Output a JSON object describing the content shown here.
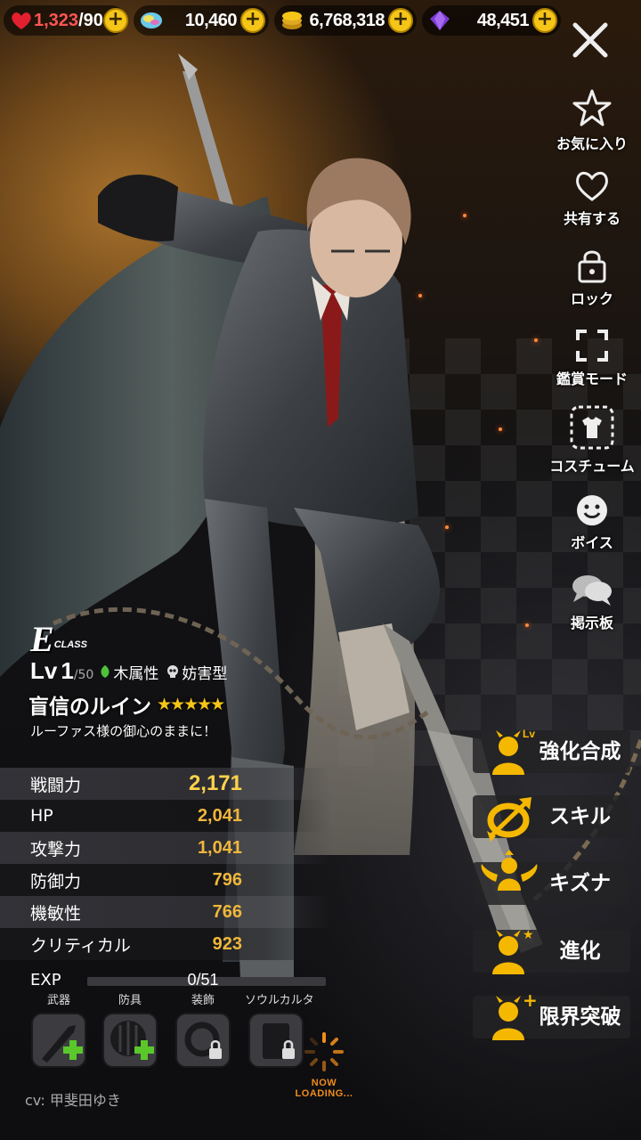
{
  "resources": [
    {
      "icon": "heart-icon",
      "value": "1,323",
      "max": "/90"
    },
    {
      "icon": "rainbow-crystal-icon",
      "value": "10,460"
    },
    {
      "icon": "gold-coin-icon",
      "value": "6,768,318"
    },
    {
      "icon": "purple-gem-icon",
      "value": "48,451"
    }
  ],
  "plus_symbol": "+",
  "side_menu": [
    {
      "icon": "star-icon",
      "label": "お気に入り"
    },
    {
      "icon": "heart-outline-icon",
      "label": "共有する"
    },
    {
      "icon": "lock-icon",
      "label": "ロック"
    },
    {
      "icon": "fullscreen-icon",
      "label": "鑑賞モード"
    },
    {
      "icon": "costume-icon",
      "label": "コスチューム"
    },
    {
      "icon": "smile-icon",
      "label": "ボイス"
    },
    {
      "icon": "chat-bubble-icon",
      "label": "掲示板"
    }
  ],
  "character": {
    "class_letter": "E",
    "class_label": "CLASS",
    "level_prefix": "Lv",
    "level": "1",
    "level_max": "/50",
    "element": "木属性",
    "type": "妨害型",
    "name": "盲信のルイン",
    "stars": "★★★★★",
    "quote": "ルーファス様の御心のままに！"
  },
  "stats": [
    {
      "label": "戦闘力",
      "value": "2,171"
    },
    {
      "label": "HP",
      "value": "2,041"
    },
    {
      "label": "攻撃力",
      "value": "1,041"
    },
    {
      "label": "防御力",
      "value": "796"
    },
    {
      "label": "機敏性",
      "value": "766"
    },
    {
      "label": "クリティカル",
      "value": "923"
    }
  ],
  "exp": {
    "label": "EXP",
    "value": "0/51",
    "progress": 0
  },
  "equipment": [
    {
      "label": "武器",
      "icon": "weapon-knife-icon"
    },
    {
      "label": "防具",
      "icon": "armor-shield-icon"
    },
    {
      "label": "装飾",
      "icon": "accessory-ring-icon"
    },
    {
      "label": "ソウルカルタ",
      "icon": "soul-card-icon"
    }
  ],
  "cv": "cv: 甲斐田ゆき",
  "loading_text": "NOW LOADING...",
  "actions": [
    {
      "label": "強化合成",
      "badge": "Lv"
    },
    {
      "label": "スキル",
      "badge": ""
    },
    {
      "label": "キズナ",
      "badge": ""
    },
    {
      "label": "進化",
      "badge": "★"
    },
    {
      "label": "限界突破",
      "badge": "+"
    }
  ],
  "colors": {
    "accent_gold": "#f5c518",
    "stat_value": "#f0b73a",
    "loading_orange": "#f08c1a"
  }
}
